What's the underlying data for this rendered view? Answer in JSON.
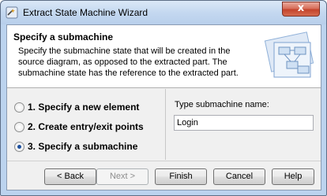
{
  "window": {
    "title": "Extract State Machine Wizard",
    "close_glyph": "x"
  },
  "header": {
    "title": "Specify a submachine",
    "description": "Specify the submachine state that will be created in the source diagram, as opposed to the extracted part. The submachine state has the reference to the extracted part."
  },
  "steps": [
    {
      "label": "1. Specify a new element",
      "checked": false
    },
    {
      "label": "2. Create entry/exit points",
      "checked": false
    },
    {
      "label": "3. Specify a submachine",
      "checked": true
    }
  ],
  "form": {
    "name_label": "Type submachine name:",
    "name_value": "Login"
  },
  "buttons": {
    "back": "< Back",
    "next": "Next >",
    "finish": "Finish",
    "cancel": "Cancel",
    "help": "Help"
  },
  "colors": {
    "titlebar": "#c4d8f0",
    "close_button": "#c4442c",
    "radio_dot": "#1c4f9e"
  },
  "icons": {
    "app": "wizard-app-icon",
    "header_graphic": "diagram-illustration",
    "close": "close-icon"
  }
}
